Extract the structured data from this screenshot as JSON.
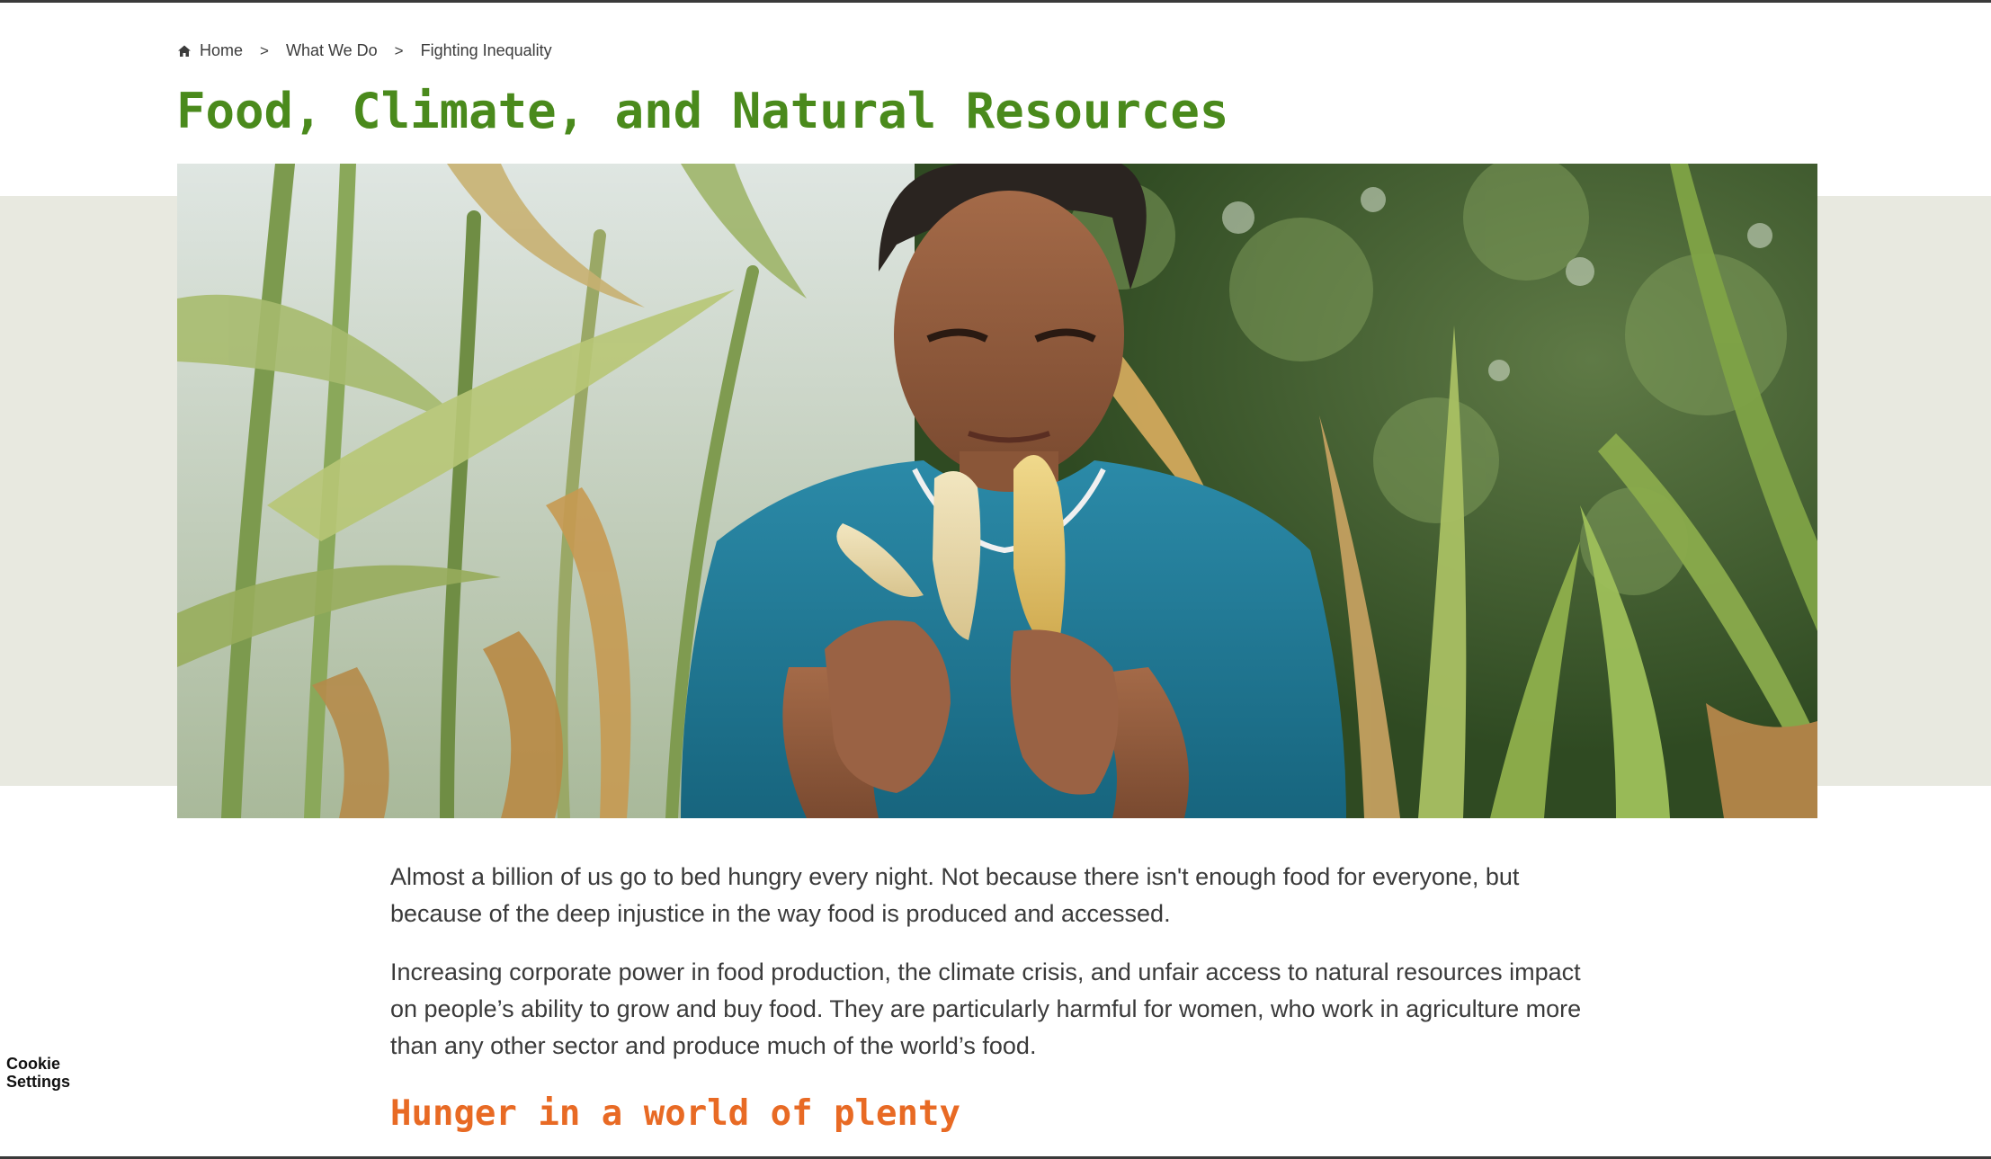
{
  "breadcrumb": {
    "items": [
      {
        "label": "Home"
      },
      {
        "label": "What We Do"
      },
      {
        "label": "Fighting Inequality"
      }
    ],
    "separator": ">"
  },
  "page": {
    "title": "Food, Climate, and Natural Resources",
    "title_color": "#4a8a1c",
    "accent_color": "#e86a24"
  },
  "hero": {
    "alt": "Woman holding ears of corn in a cornfield"
  },
  "content": {
    "paragraphs": [
      "Almost a billion of us go to bed hungry every night. Not because there isn't enough food for everyone, but because of the deep injustice in the way food is produced and accessed.",
      "Increasing corporate power in food production, the climate crisis, and unfair access to natural resources impact on people’s ability to grow and buy food. They are particularly harmful for women, who work in agriculture more than any other sector and produce much of the world’s food."
    ],
    "section_heading": "Hunger in a world of plenty"
  },
  "cookie": {
    "label": "Cookie Settings"
  }
}
